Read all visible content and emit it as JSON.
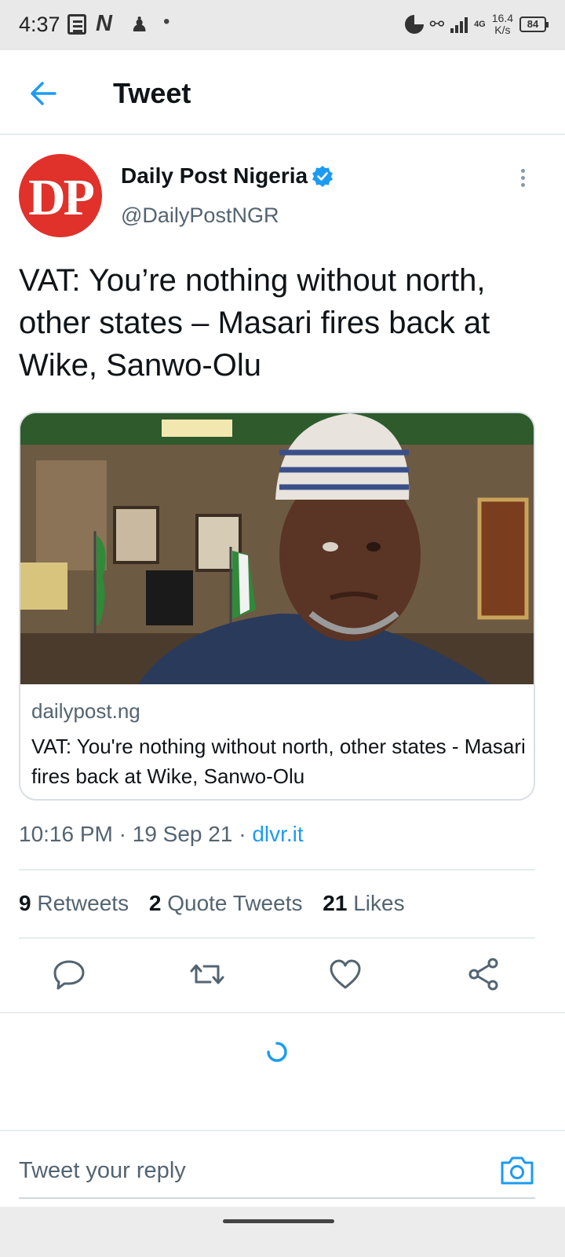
{
  "status_bar": {
    "time": "4:37",
    "icons_left": [
      "news-icon",
      "n-icon",
      "person-add-icon",
      "dot-icon"
    ],
    "icons_right": [
      "data-saver-icon",
      "vpn-key-icon",
      "signal-icon",
      "lte-signal-icon"
    ],
    "lte_label": "4G",
    "speed_value": "16.4",
    "speed_unit": "K/s",
    "battery": "84"
  },
  "header": {
    "title": "Tweet",
    "back_icon": "arrow-left-icon"
  },
  "tweet": {
    "avatar_text": "DP",
    "display_name": "Daily Post Nigeria",
    "verified": true,
    "handle": "@DailyPostNGR",
    "text": "VAT: You’re nothing without north, other states – Masari fires back at Wike, Sanwo-Olu",
    "card": {
      "domain": "dailypost.ng",
      "title": "VAT: You're nothing without north, other states - Masari fires back at Wike, Sanwo-Olu"
    },
    "time": "10:16 PM",
    "sep1": "·",
    "date": "19 Sep 21",
    "sep2": "·",
    "source": "dlvr.it"
  },
  "stats": {
    "retweets_count": "9",
    "retweets_label": "Retweets",
    "quotes_count": "2",
    "quotes_label": "Quote Tweets",
    "likes_count": "21",
    "likes_label": "Likes"
  },
  "actions": [
    "reply-icon",
    "retweet-icon",
    "like-icon",
    "share-icon"
  ],
  "reply": {
    "placeholder": "Tweet your reply"
  },
  "colors": {
    "accent": "#1d9bf0",
    "brand_red": "#e0312b",
    "secondary_text": "#536471"
  }
}
